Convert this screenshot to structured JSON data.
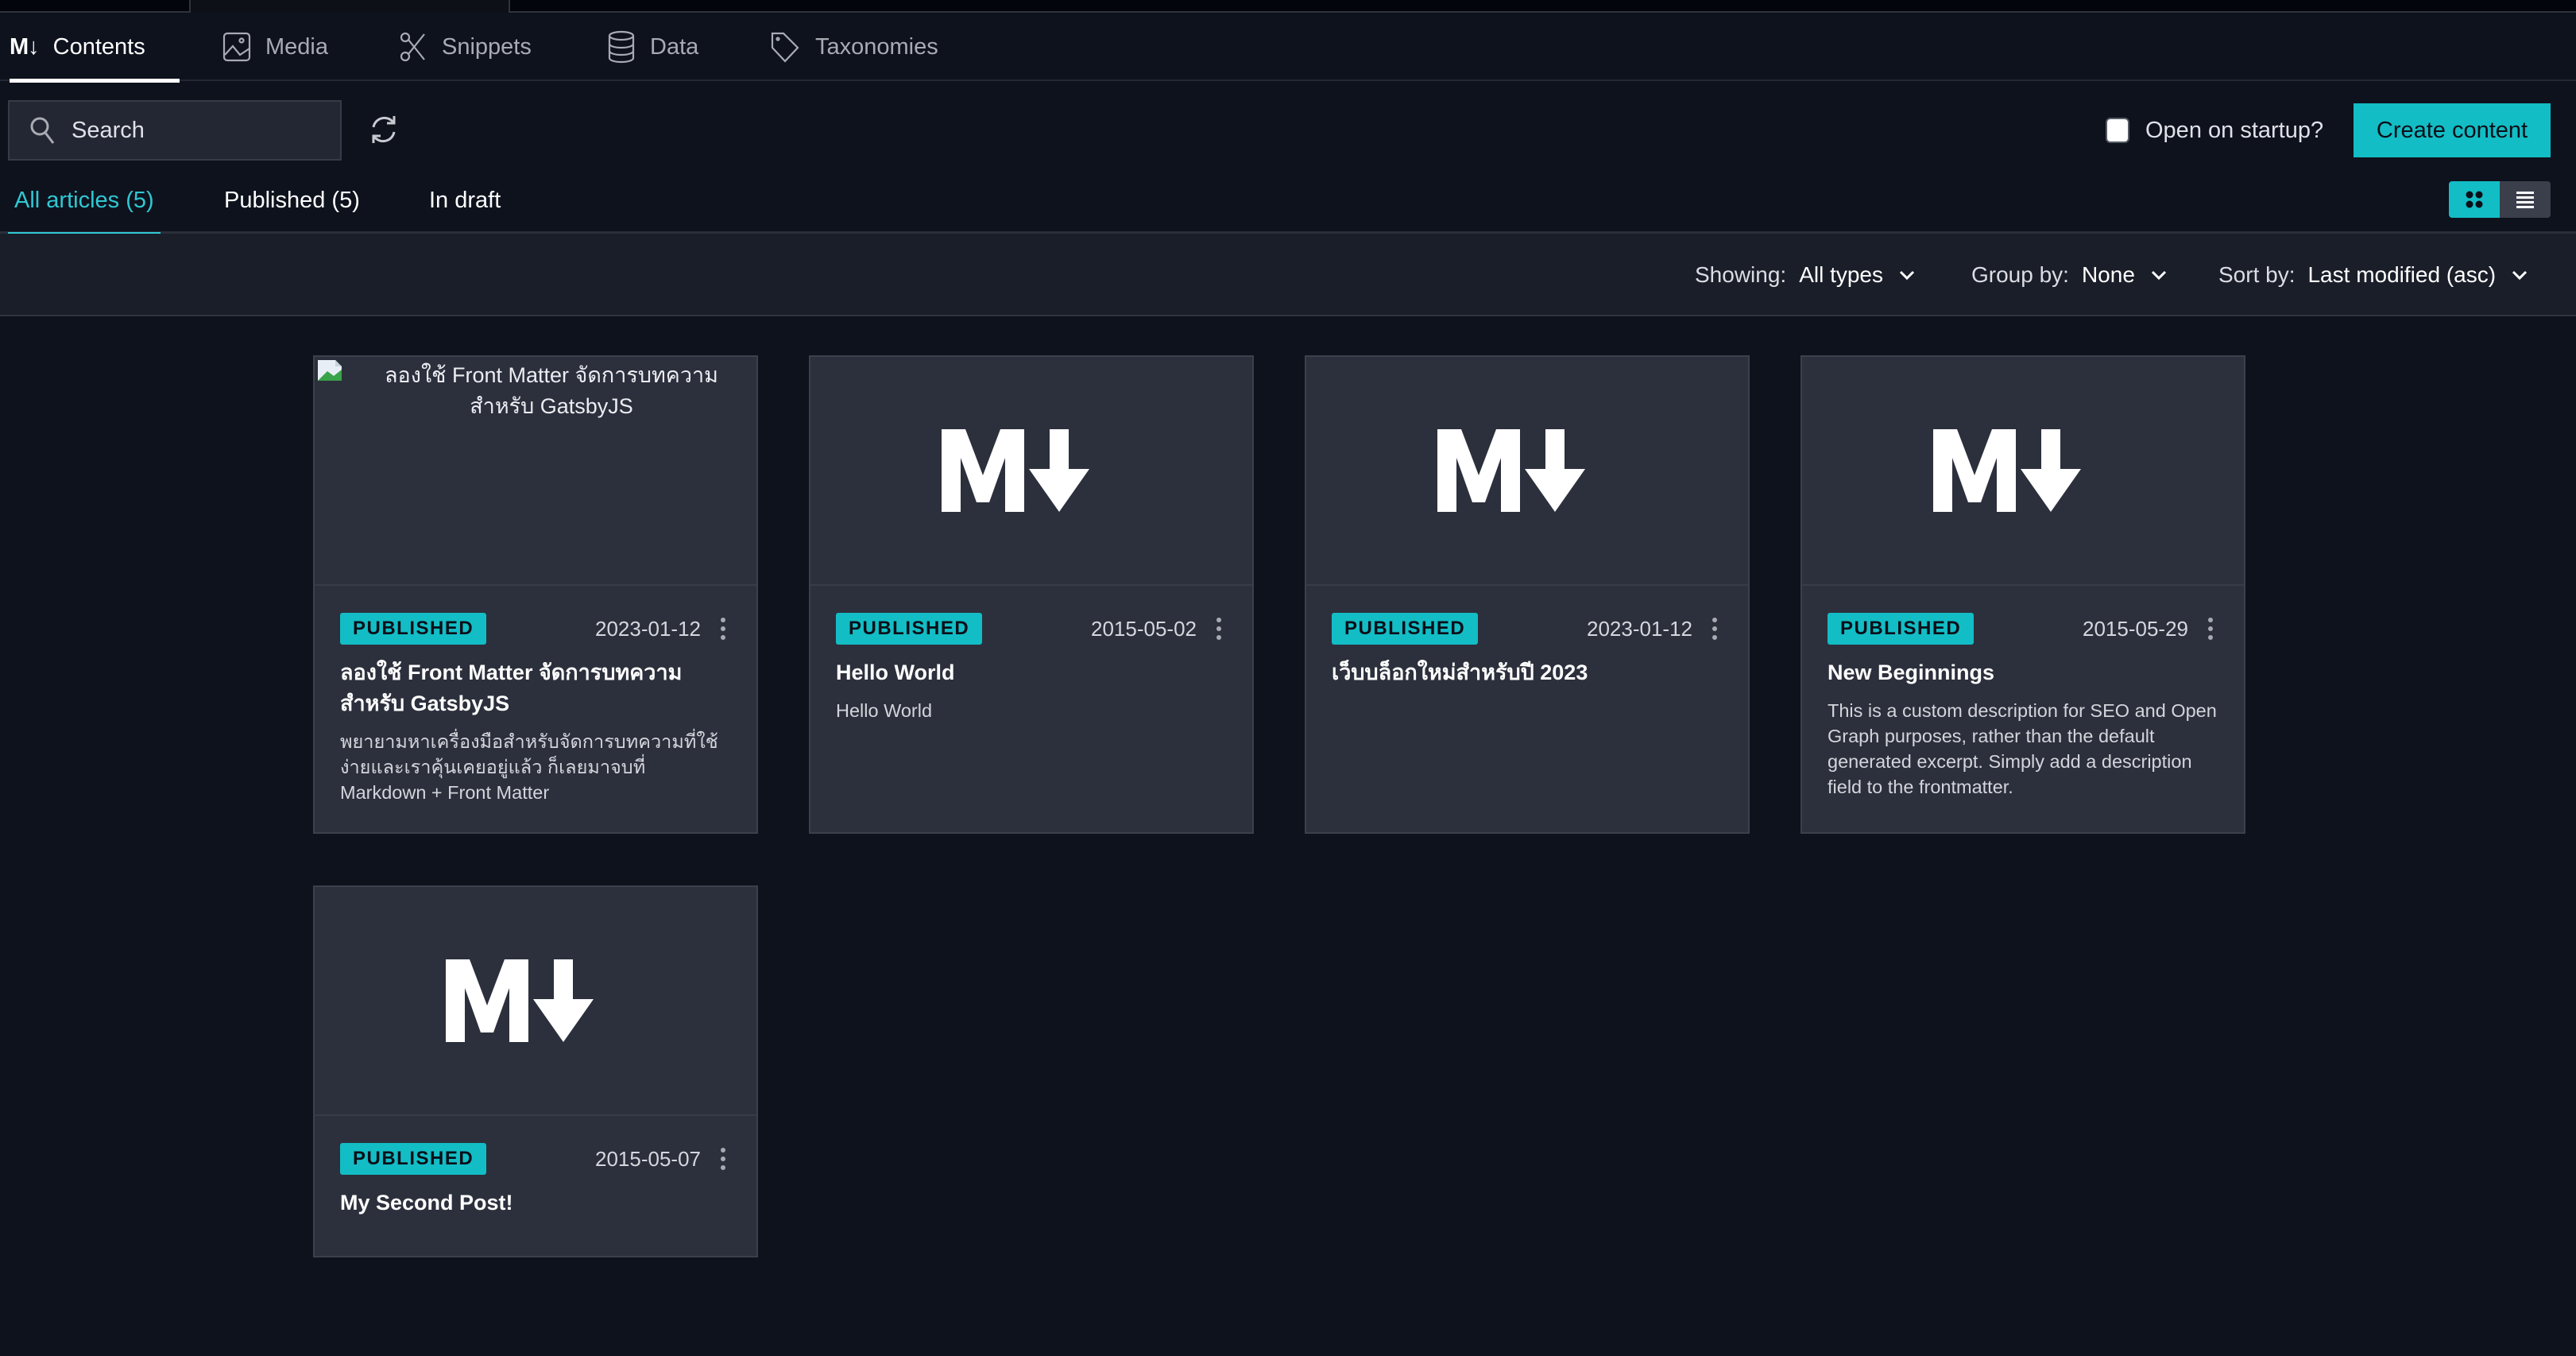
{
  "nav": {
    "tabs": [
      {
        "label": "Contents",
        "icon": "markdown-icon",
        "active": true
      },
      {
        "label": "Media",
        "icon": "image-icon",
        "active": false
      },
      {
        "label": "Snippets",
        "icon": "scissors-icon",
        "active": false
      },
      {
        "label": "Data",
        "icon": "database-icon",
        "active": false
      },
      {
        "label": "Taxonomies",
        "icon": "tag-icon",
        "active": false
      }
    ],
    "contents_glyph": "M↓"
  },
  "toolbar": {
    "search_placeholder": "Search",
    "refresh_icon": "refresh-icon",
    "open_on_startup_label": "Open on startup?",
    "open_on_startup_checked": false,
    "create_label": "Create content"
  },
  "subtabs": [
    {
      "label": "All articles (5)",
      "active": true
    },
    {
      "label": "Published (5)",
      "active": false
    },
    {
      "label": "In draft",
      "active": false
    }
  ],
  "view_toggle": {
    "active": "grid",
    "options": [
      "grid",
      "list"
    ]
  },
  "filters": {
    "showing": {
      "label": "Showing:",
      "value": "All types"
    },
    "group_by": {
      "label": "Group by:",
      "value": "None"
    },
    "sort_by": {
      "label": "Sort by:",
      "value": "Last modified (asc)"
    }
  },
  "colors": {
    "accent": "#13bdc5",
    "background": "#0e121d",
    "card": "#2c303c"
  },
  "articles": [
    {
      "status": "PUBLISHED",
      "date": "2023-01-12",
      "title": "ลองใช้ Front Matter จัดการบทความสำหรับ GatsbyJS",
      "description": "พยายามหาเครื่องมือสำหรับจัดการบทความที่ใช้ง่ายและเราคุ้นเคยอยู่แล้ว ก็เลยมาจบที่ Markdown + Front Matter",
      "image_alt": "ลองใช้ Front Matter จัดการบทความสำหรับ GatsbyJS",
      "thumb": "broken-image"
    },
    {
      "status": "PUBLISHED",
      "date": "2015-05-02",
      "title": "Hello World",
      "description": "Hello World",
      "thumb": "markdown"
    },
    {
      "status": "PUBLISHED",
      "date": "2023-01-12",
      "title": "เว็บบล็อกใหม่สำหรับปี 2023",
      "description": "",
      "thumb": "markdown"
    },
    {
      "status": "PUBLISHED",
      "date": "2015-05-29",
      "title": "New Beginnings",
      "description": "This is a custom description for SEO and Open Graph purposes, rather than the default generated excerpt. Simply add a description field to the frontmatter.",
      "thumb": "markdown"
    },
    {
      "status": "PUBLISHED",
      "date": "2015-05-07",
      "title": "My Second Post!",
      "description": "",
      "thumb": "markdown"
    }
  ]
}
